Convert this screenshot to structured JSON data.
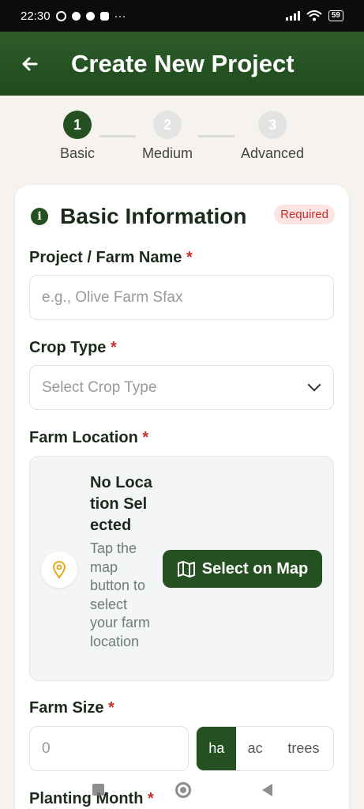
{
  "status": {
    "time": "22:30",
    "dots": "···",
    "battery": "59"
  },
  "header": {
    "title": "Create New Project",
    "back_icon": "arrow-left-icon"
  },
  "stepper": {
    "steps": [
      {
        "num": "1",
        "label": "Basic"
      },
      {
        "num": "2",
        "label": "Medium"
      },
      {
        "num": "3",
        "label": "Advanced"
      }
    ]
  },
  "section": {
    "title": "Basic Information",
    "badge": "Required"
  },
  "fields": {
    "project_name": {
      "label": "Project / Farm Name",
      "required": "*",
      "placeholder": "e.g., Olive Farm Sfax"
    },
    "crop_type": {
      "label": "Crop Type",
      "required": "*",
      "placeholder": "Select Crop Type"
    },
    "location": {
      "label": "Farm Location",
      "required": "*",
      "title": "No Location Selected",
      "description": "Tap the map button to select your farm location",
      "button": "Select on Map"
    },
    "size": {
      "label": "Farm Size",
      "required": "*",
      "placeholder": "0",
      "units": [
        "ha",
        "ac",
        "trees"
      ],
      "selected_unit": "ha"
    },
    "planting_month": {
      "label": "Planting Month",
      "required": "*"
    }
  },
  "colors": {
    "primary": "#245022",
    "required": "#c9302c"
  }
}
